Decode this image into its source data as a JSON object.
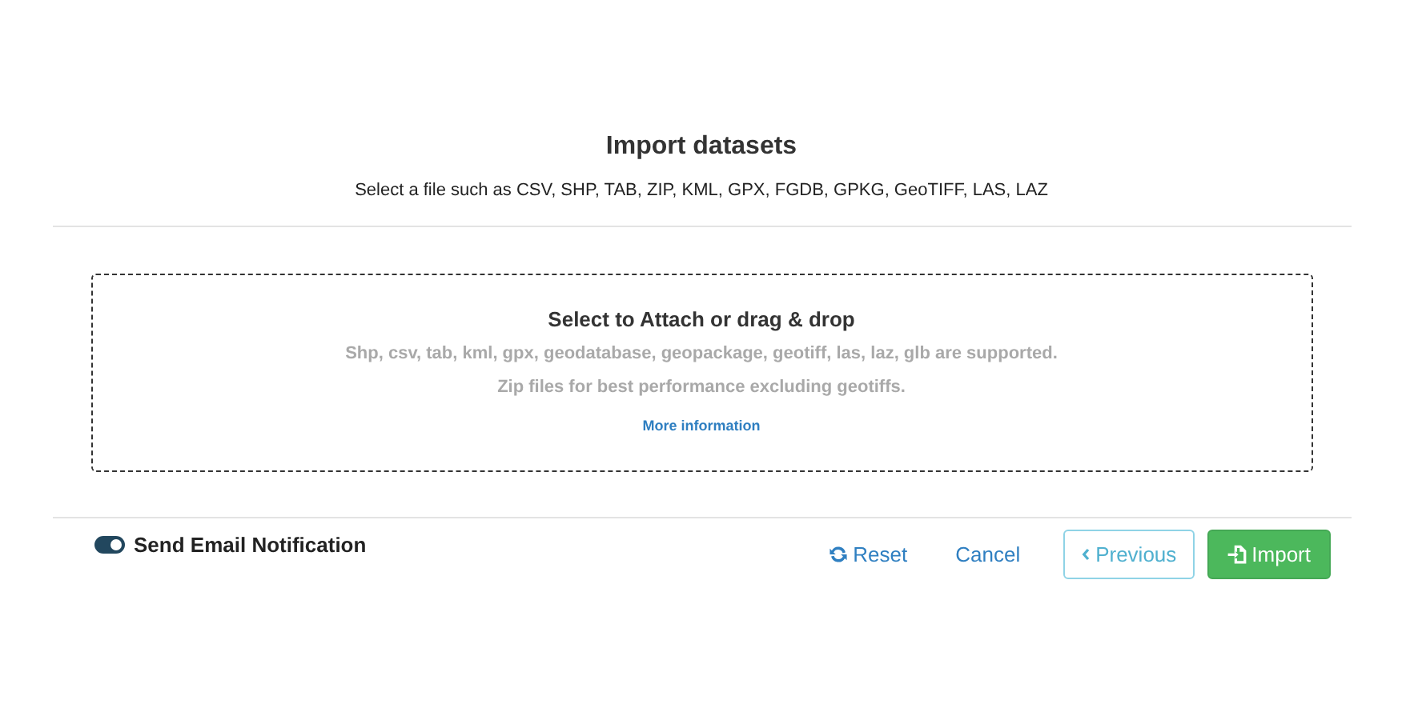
{
  "dialog": {
    "title": "Import datasets",
    "subtitle": "Select a file such as CSV, SHP, TAB, ZIP, KML, GPX, FGDB, GPKG, GeoTIFF, LAS, LAZ"
  },
  "dropzone": {
    "heading": "Select to Attach or drag & drop",
    "notes": [
      "Shp, csv, tab, kml, gpx, geodatabase, geopackage, geotiff, las, laz, glb are supported.",
      "Zip files for best performance excluding geotiffs."
    ],
    "link": "More information"
  },
  "email_toggle": {
    "label": "Send Email Notification",
    "on": true
  },
  "buttons": [
    {
      "kind": "reset",
      "label": "Reset",
      "disabled": false
    },
    {
      "kind": "cancel",
      "label": "Cancel",
      "disabled": false
    },
    {
      "kind": "previous",
      "label": "Previous",
      "disabled": true
    },
    {
      "kind": "import",
      "label": "Import",
      "disabled": false
    }
  ]
}
